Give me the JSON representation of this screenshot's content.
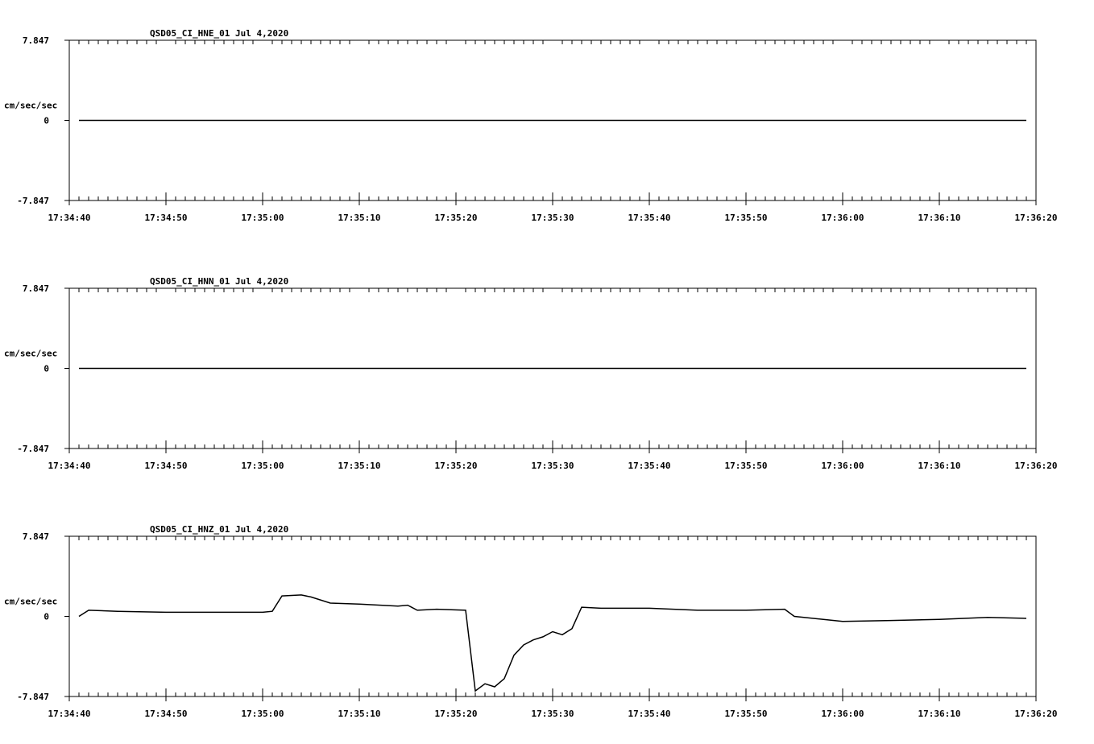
{
  "chart_data": [
    {
      "type": "line",
      "title": "QSD05_CI_HNE_01  Jul 4,2020",
      "ylabel": "cm/sec/sec",
      "ylim": [
        -7.847,
        7.847
      ],
      "y_ticks": [
        "7.847",
        "0",
        "-7.847"
      ],
      "x_ticks": [
        "17:34:40",
        "17:34:50",
        "17:35:00",
        "17:35:10",
        "17:35:20",
        "17:35:30",
        "17:35:40",
        "17:35:50",
        "17:36:00",
        "17:36:10",
        "17:36:20"
      ],
      "xlim": [
        "17:34:40",
        "17:36:20"
      ],
      "grid": false,
      "series": [
        {
          "x": [
            "17:34:41",
            "17:34:45",
            "17:35:00",
            "17:35:20",
            "17:35:40",
            "17:36:00",
            "17:36:19"
          ],
          "values": [
            0,
            0,
            0,
            0,
            0,
            0,
            0
          ]
        }
      ]
    },
    {
      "type": "line",
      "title": "QSD05_CI_HNN_01  Jul 4,2020",
      "ylabel": "cm/sec/sec",
      "ylim": [
        -7.847,
        7.847
      ],
      "y_ticks": [
        "7.847",
        "0",
        "-7.847"
      ],
      "x_ticks": [
        "17:34:40",
        "17:34:50",
        "17:35:00",
        "17:35:10",
        "17:35:20",
        "17:35:30",
        "17:35:40",
        "17:35:50",
        "17:36:00",
        "17:36:10",
        "17:36:20"
      ],
      "xlim": [
        "17:34:40",
        "17:36:20"
      ],
      "grid": false,
      "series": [
        {
          "x": [
            "17:34:41",
            "17:34:50",
            "17:35:00",
            "17:35:10",
            "17:35:20",
            "17:35:30",
            "17:35:40",
            "17:35:50",
            "17:36:00",
            "17:36:10",
            "17:36:19"
          ],
          "values": [
            0,
            0,
            0,
            0,
            0,
            0,
            0,
            0,
            0,
            0,
            0
          ]
        }
      ]
    },
    {
      "type": "line",
      "title": "QSD05_CI_HNZ_01  Jul 4,2020",
      "ylabel": "cm/sec/sec",
      "ylim": [
        -7.847,
        7.847
      ],
      "y_ticks": [
        "7.847",
        "0",
        "-7.847"
      ],
      "x_ticks": [
        "17:34:40",
        "17:34:50",
        "17:35:00",
        "17:35:10",
        "17:35:20",
        "17:35:30",
        "17:35:40",
        "17:35:50",
        "17:36:00",
        "17:36:10",
        "17:36:20"
      ],
      "xlim": [
        "17:34:40",
        "17:36:20"
      ],
      "grid": false,
      "series": [
        {
          "x": [
            "17:34:41",
            "17:34:42",
            "17:34:45",
            "17:34:50",
            "17:34:55",
            "17:35:00",
            "17:35:01",
            "17:35:02",
            "17:35:04",
            "17:35:05",
            "17:35:07",
            "17:35:10",
            "17:35:14",
            "17:35:15",
            "17:35:16",
            "17:35:18",
            "17:35:21",
            "17:35:22",
            "17:35:23",
            "17:35:24",
            "17:35:25",
            "17:35:26",
            "17:35:27",
            "17:35:28",
            "17:35:29",
            "17:35:30",
            "17:35:31",
            "17:35:32",
            "17:35:33",
            "17:35:35",
            "17:35:40",
            "17:35:45",
            "17:35:50",
            "17:35:54",
            "17:35:55",
            "17:35:58",
            "17:36:00",
            "17:36:05",
            "17:36:10",
            "17:36:15",
            "17:36:19"
          ],
          "values": [
            0.0,
            0.6,
            0.5,
            0.4,
            0.4,
            0.4,
            0.5,
            2.0,
            2.1,
            1.9,
            1.3,
            1.2,
            1.0,
            1.1,
            0.6,
            0.7,
            0.6,
            -7.3,
            -6.6,
            -6.9,
            -6.1,
            -3.8,
            -2.8,
            -2.3,
            -2.0,
            -1.5,
            -1.8,
            -1.2,
            0.9,
            0.8,
            0.8,
            0.6,
            0.6,
            0.7,
            0.0,
            -0.3,
            -0.5,
            -0.4,
            -0.3,
            -0.1,
            -0.2
          ]
        }
      ]
    }
  ]
}
